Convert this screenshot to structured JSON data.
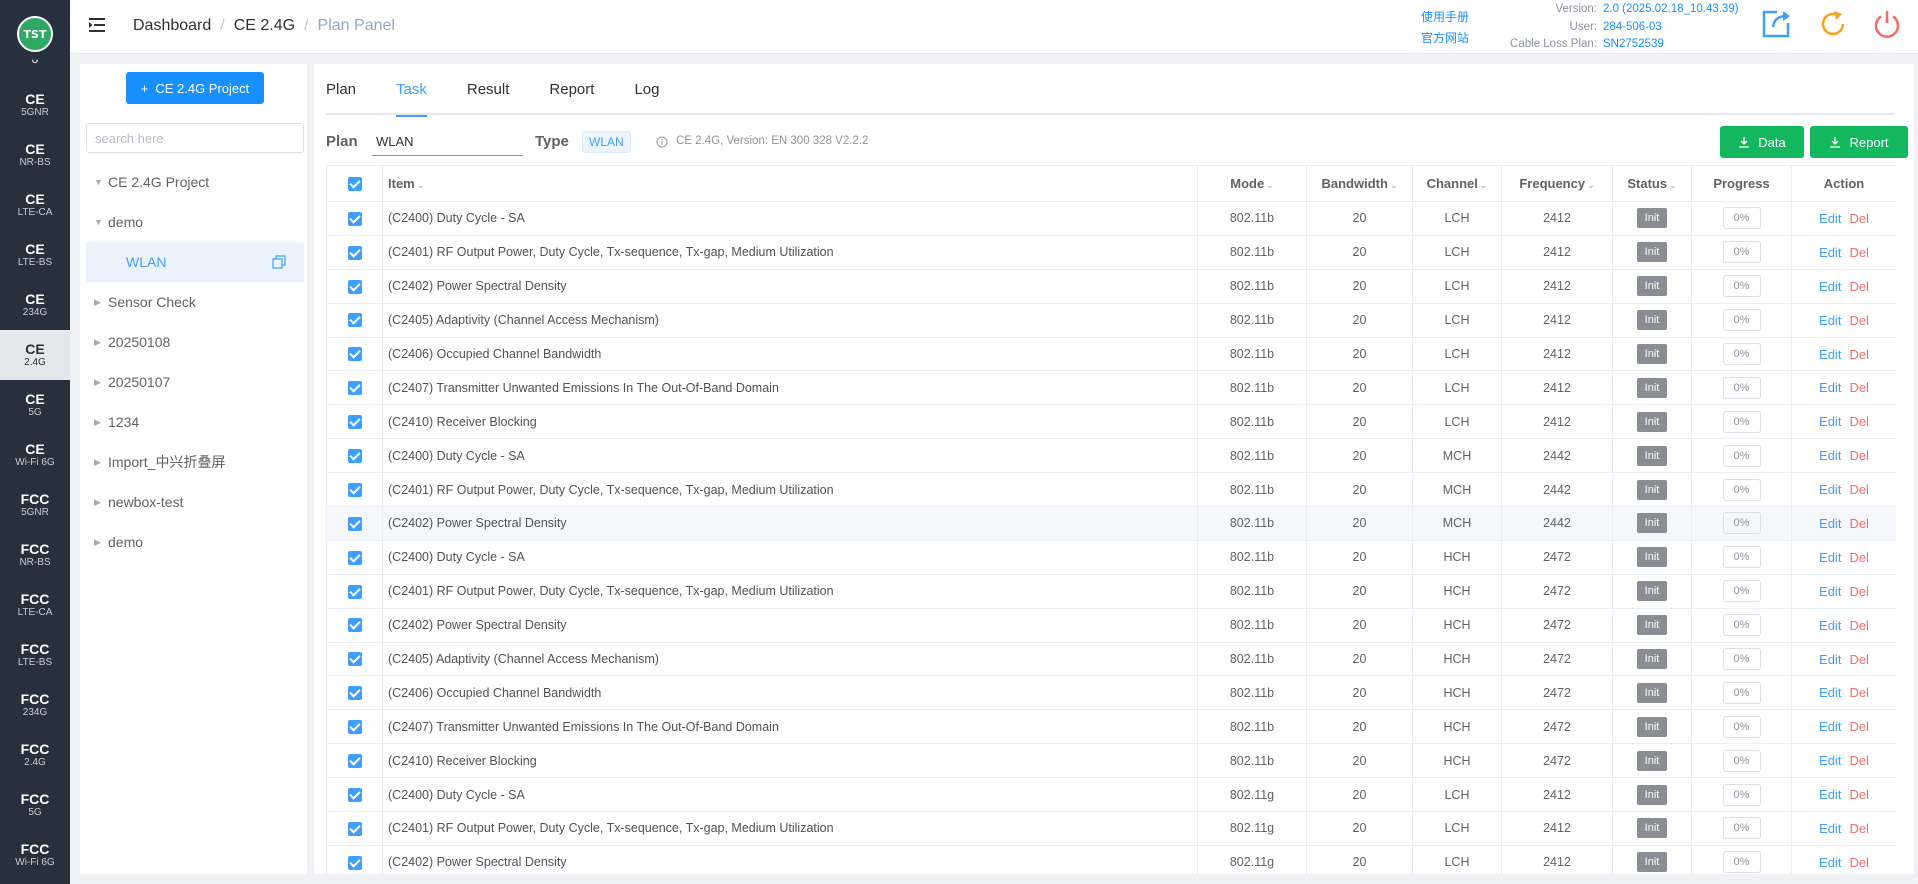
{
  "app": {
    "logo_text": "TST",
    "logo_tail": "ᴗ"
  },
  "rail": [
    {
      "t1": "CE",
      "t2": "5GNR"
    },
    {
      "t1": "CE",
      "t2": "NR-BS"
    },
    {
      "t1": "CE",
      "t2": "LTE-CA"
    },
    {
      "t1": "CE",
      "t2": "LTE-BS"
    },
    {
      "t1": "CE",
      "t2": "234G"
    },
    {
      "t1": "CE",
      "t2": "2.4G"
    },
    {
      "t1": "CE",
      "t2": "5G"
    },
    {
      "t1": "CE",
      "t2": "Wi-Fi 6G"
    },
    {
      "t1": "FCC",
      "t2": "5GNR"
    },
    {
      "t1": "FCC",
      "t2": "NR-BS"
    },
    {
      "t1": "FCC",
      "t2": "LTE-CA"
    },
    {
      "t1": "FCC",
      "t2": "LTE-BS"
    },
    {
      "t1": "FCC",
      "t2": "234G"
    },
    {
      "t1": "FCC",
      "t2": "2.4G"
    },
    {
      "t1": "FCC",
      "t2": "5G"
    },
    {
      "t1": "FCC",
      "t2": "Wi-Fi 6G"
    }
  ],
  "header": {
    "breadcrumb": [
      "Dashboard",
      "CE 2.4G",
      "Plan Panel"
    ],
    "links": [
      "使用手册",
      "官方网站"
    ],
    "version_label": "Version:",
    "version_value": "2.0 (2025.02.18_10.43.39)",
    "user_label": "User:",
    "user_value": "284-506-03",
    "cable_label": "Cable Loss Plan:",
    "cable_value": "SN2752539"
  },
  "sidebar": {
    "project_button": "CE 2.4G Project",
    "search_placeholder": "search here",
    "tree": [
      {
        "label": "CE 2.4G Project",
        "level": 1,
        "arrow": "▼"
      },
      {
        "label": "demo",
        "level": 2,
        "arrow": "▼"
      },
      {
        "label": "WLAN",
        "level": 3,
        "arrow": ""
      },
      {
        "label": "Sensor Check",
        "level": 2,
        "arrow": "▶"
      },
      {
        "label": "20250108",
        "level": 2,
        "arrow": "▶"
      },
      {
        "label": "20250107",
        "level": 2,
        "arrow": "▶"
      },
      {
        "label": "1234",
        "level": 2,
        "arrow": "▶"
      },
      {
        "label": "Import_中兴折叠屏",
        "level": 2,
        "arrow": "▶"
      },
      {
        "label": "newbox-test",
        "level": 2,
        "arrow": "▶"
      },
      {
        "label": "demo",
        "level": 2,
        "arrow": "▶"
      }
    ]
  },
  "main": {
    "tabs": [
      "Plan",
      "Task",
      "Result",
      "Report",
      "Log"
    ],
    "active_tab": "Task",
    "plan_label": "Plan",
    "plan_value": "WLAN",
    "type_label": "Type",
    "type_value": "WLAN",
    "info": "CE 2.4G, Version: EN 300 328 V2.2.2",
    "data_button": "Data",
    "report_button": "Report",
    "columns": [
      "Item",
      "Mode",
      "Bandwidth",
      "Channel",
      "Frequency",
      "Status",
      "Progress",
      "Action"
    ],
    "edit_label": "Edit",
    "del_label": "Del",
    "rows": [
      {
        "item": "(C2400) Duty Cycle - SA",
        "mode": "802.11b",
        "bw": "20",
        "ch": "LCH",
        "freq": "2412",
        "status": "Init",
        "progress": "0%"
      },
      {
        "item": "(C2401) RF Output Power, Duty Cycle, Tx-sequence, Tx-gap, Medium Utilization",
        "mode": "802.11b",
        "bw": "20",
        "ch": "LCH",
        "freq": "2412",
        "status": "Init",
        "progress": "0%"
      },
      {
        "item": "(C2402) Power Spectral Density",
        "mode": "802.11b",
        "bw": "20",
        "ch": "LCH",
        "freq": "2412",
        "status": "Init",
        "progress": "0%"
      },
      {
        "item": "(C2405) Adaptivity (Channel Access Mechanism)",
        "mode": "802.11b",
        "bw": "20",
        "ch": "LCH",
        "freq": "2412",
        "status": "Init",
        "progress": "0%"
      },
      {
        "item": "(C2406) Occupied Channel Bandwidth",
        "mode": "802.11b",
        "bw": "20",
        "ch": "LCH",
        "freq": "2412",
        "status": "Init",
        "progress": "0%"
      },
      {
        "item": "(C2407) Transmitter Unwanted Emissions In The Out-Of-Band Domain",
        "mode": "802.11b",
        "bw": "20",
        "ch": "LCH",
        "freq": "2412",
        "status": "Init",
        "progress": "0%"
      },
      {
        "item": "(C2410) Receiver Blocking",
        "mode": "802.11b",
        "bw": "20",
        "ch": "LCH",
        "freq": "2412",
        "status": "Init",
        "progress": "0%"
      },
      {
        "item": "(C2400) Duty Cycle - SA",
        "mode": "802.11b",
        "bw": "20",
        "ch": "MCH",
        "freq": "2442",
        "status": "Init",
        "progress": "0%"
      },
      {
        "item": "(C2401) RF Output Power, Duty Cycle, Tx-sequence, Tx-gap, Medium Utilization",
        "mode": "802.11b",
        "bw": "20",
        "ch": "MCH",
        "freq": "2442",
        "status": "Init",
        "progress": "0%"
      },
      {
        "item": "(C2402) Power Spectral Density",
        "mode": "802.11b",
        "bw": "20",
        "ch": "MCH",
        "freq": "2442",
        "status": "Init",
        "progress": "0%"
      },
      {
        "item": "(C2400) Duty Cycle - SA",
        "mode": "802.11b",
        "bw": "20",
        "ch": "HCH",
        "freq": "2472",
        "status": "Init",
        "progress": "0%"
      },
      {
        "item": "(C2401) RF Output Power, Duty Cycle, Tx-sequence, Tx-gap, Medium Utilization",
        "mode": "802.11b",
        "bw": "20",
        "ch": "HCH",
        "freq": "2472",
        "status": "Init",
        "progress": "0%"
      },
      {
        "item": "(C2402) Power Spectral Density",
        "mode": "802.11b",
        "bw": "20",
        "ch": "HCH",
        "freq": "2472",
        "status": "Init",
        "progress": "0%"
      },
      {
        "item": "(C2405) Adaptivity (Channel Access Mechanism)",
        "mode": "802.11b",
        "bw": "20",
        "ch": "HCH",
        "freq": "2472",
        "status": "Init",
        "progress": "0%"
      },
      {
        "item": "(C2406) Occupied Channel Bandwidth",
        "mode": "802.11b",
        "bw": "20",
        "ch": "HCH",
        "freq": "2472",
        "status": "Init",
        "progress": "0%"
      },
      {
        "item": "(C2407) Transmitter Unwanted Emissions In The Out-Of-Band Domain",
        "mode": "802.11b",
        "bw": "20",
        "ch": "HCH",
        "freq": "2472",
        "status": "Init",
        "progress": "0%"
      },
      {
        "item": "(C2410) Receiver Blocking",
        "mode": "802.11b",
        "bw": "20",
        "ch": "HCH",
        "freq": "2472",
        "status": "Init",
        "progress": "0%"
      },
      {
        "item": "(C2400) Duty Cycle - SA",
        "mode": "802.11g",
        "bw": "20",
        "ch": "LCH",
        "freq": "2412",
        "status": "Init",
        "progress": "0%"
      },
      {
        "item": "(C2401) RF Output Power, Duty Cycle, Tx-sequence, Tx-gap, Medium Utilization",
        "mode": "802.11g",
        "bw": "20",
        "ch": "LCH",
        "freq": "2412",
        "status": "Init",
        "progress": "0%"
      },
      {
        "item": "(C2402) Power Spectral Density",
        "mode": "802.11g",
        "bw": "20",
        "ch": "LCH",
        "freq": "2412",
        "status": "Init",
        "progress": "0%"
      }
    ]
  },
  "colors": {
    "rail_bg": "#27313d",
    "accent_blue": "#409eff",
    "button_green": "#13b85e",
    "status_gray": "#8a8d93",
    "del_red": "#f56c6c"
  }
}
